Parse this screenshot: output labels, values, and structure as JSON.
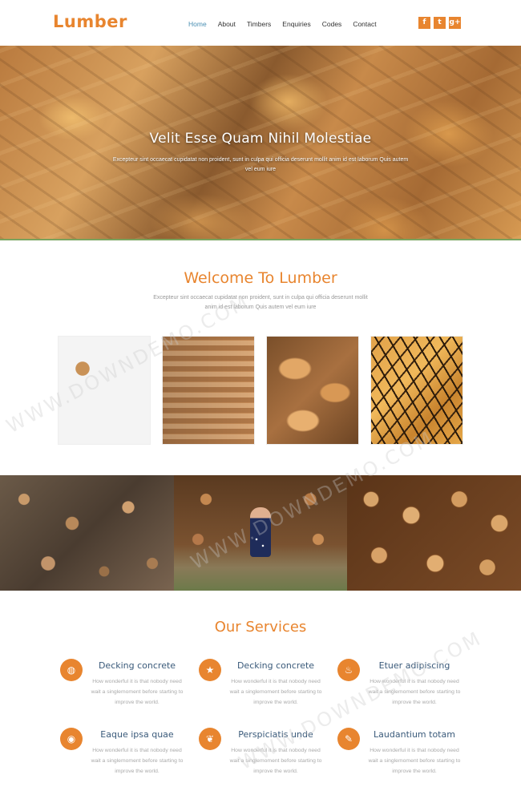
{
  "brand": {
    "logo": "Lumber",
    "accent": "#e8852f"
  },
  "nav": {
    "items": [
      {
        "label": "Home",
        "active": true
      },
      {
        "label": "About",
        "active": false
      },
      {
        "label": "Timbers",
        "active": false
      },
      {
        "label": "Enquiries",
        "active": false
      },
      {
        "label": "Codes",
        "active": false
      },
      {
        "label": "Contact",
        "active": false
      }
    ]
  },
  "social": [
    {
      "icon": "facebook-icon",
      "glyph": "f"
    },
    {
      "icon": "twitter-icon",
      "glyph": "t"
    },
    {
      "icon": "google-plus-icon",
      "glyph": "g+"
    }
  ],
  "hero": {
    "title": "Velit Esse Quam Nihil Molestiae",
    "text": "Excepteur sint occaecat cupidatat non proident, sunt in culpa qui officia deserunt mollit anim id est laborum Quis autem vel eum iure"
  },
  "welcome": {
    "title": "Welcome To Lumber",
    "text": "Excepteur sint occaecat cupidatat non proident, sunt in culpa qui officia deserunt mollit anim id est laborum Quis autem vel eum iure"
  },
  "services": {
    "title": "Our Services",
    "items": [
      {
        "icon": "globe-icon",
        "glyph": "◍",
        "title": "Decking concrete",
        "text": "How wonderful it is that nobody need wait a singlemoment before starting to improve the world."
      },
      {
        "icon": "star-icon",
        "glyph": "★",
        "title": "Decking concrete",
        "text": "How wonderful it is that nobody need wait a singlemoment before starting to improve the world."
      },
      {
        "icon": "fire-icon",
        "glyph": "♨",
        "title": "Etuer adipiscing",
        "text": "How wonderful it is that nobody need wait a singlemoment before starting to improve the world."
      },
      {
        "icon": "circle-dot-icon",
        "glyph": "◉",
        "title": "Eaque ipsa quae",
        "text": "How wonderful it is that nobody need wait a singlemoment before starting to improve the world."
      },
      {
        "icon": "leaf-icon",
        "glyph": "❦",
        "title": "Perspiciatis unde",
        "text": "How wonderful it is that nobody need wait a singlemoment before starting to improve the world."
      },
      {
        "icon": "wrench-icon",
        "glyph": "✎",
        "title": "Laudantium totam",
        "text": "How wonderful it is that nobody need wait a singlemoment before starting to improve the world."
      }
    ]
  },
  "watermark": "WWW.DOWNDEMO.COM"
}
